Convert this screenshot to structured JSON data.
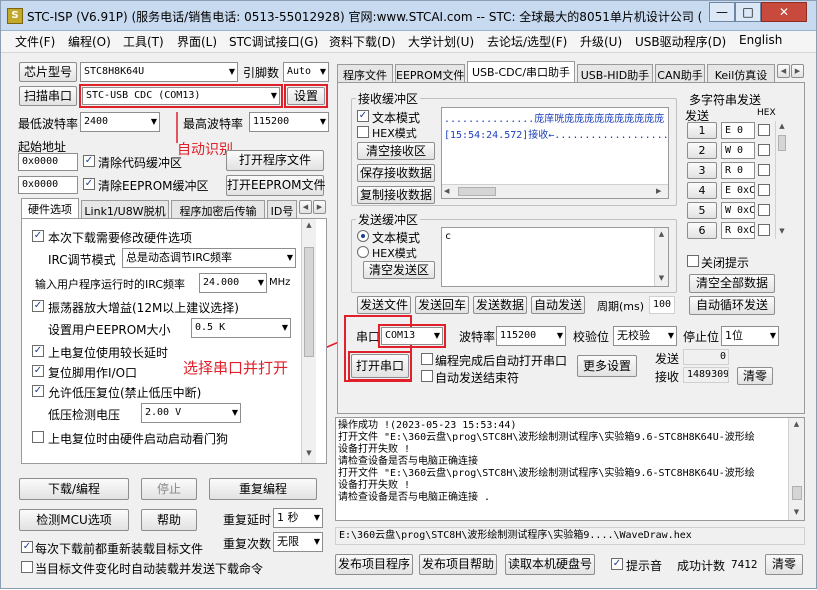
{
  "window": {
    "title": "STC-ISP (V6.91P) (服务电话/销售电话: 0513-55012928) 官网:www.STCAI.com  -- STC: 全球最大的8051单片机设计公司 (",
    "icon": "stc-chip-icon",
    "minimize": "—",
    "maximize": "□",
    "close": "✕"
  },
  "menu": [
    "文件(F)",
    "编程(O)",
    "工具(T)",
    "界面(L)",
    "STC调试接口(G)",
    "资料下载(D)",
    "大学计划(U)",
    "去论坛/选型(F)",
    "升级(U)",
    "USB驱动程序(D)",
    "English"
  ],
  "left": {
    "chip_btn": "芯片型号",
    "chip_value": "STC8H8K64U",
    "pins_label": "引脚数",
    "pins_value": "Auto",
    "scan_btn": "扫描串口",
    "port_value": "STC-USB CDC (COM13)",
    "settings_btn": "设置",
    "min_baud_label": "最低波特率",
    "min_baud_value": "2400",
    "max_baud_label": "最高波特率",
    "max_baud_value": "115200",
    "start_addr_label": "起始地址",
    "addr1": "0x0000",
    "clear_code": "清除代码缓冲区",
    "open_prog_btn": "打开程序文件",
    "addr2": "0x0000",
    "clear_eeprom": "清除EEPROM缓冲区",
    "open_eeprom_btn": "打开EEPROM文件",
    "annotation_auto": "自动识别",
    "tabs": [
      "硬件选项",
      "Link1/U8W脱机",
      "程序加密后传输",
      "ID号"
    ],
    "opt1": "本次下载需要修改硬件选项",
    "irc_label": "IRC调节模式",
    "irc_value": "总是动态调节IRC频率",
    "freq_label": "输入用户程序运行时的IRC频率",
    "freq_value": "24.000",
    "freq_unit": "MHz",
    "opt2": "振荡器放大增益(12M以上建议选择)",
    "eeprom_label": "设置用户EEPROM大小",
    "eeprom_value": "0.5 K",
    "opt3": "上电复位使用较长延时",
    "opt4": "复位脚用作I/O口",
    "opt5": "允许低压复位(禁止低压中断)",
    "lv_label": "低压检测电压",
    "lv_value": "2.00 V",
    "opt6": "上电复位时由硬件启动启动看门狗",
    "download_btn": "下载/编程",
    "stop_btn": "停止",
    "reprog_btn": "重复编程",
    "detect_btn": "检测MCU选项",
    "help_btn": "帮助",
    "repeat_delay_label": "重复延时",
    "repeat_delay_value": "1 秒",
    "reload_opt": "每次下载前都重新装载目标文件",
    "repeat_count_label": "重复次数",
    "repeat_count_value": "无限",
    "auto_load_opt": "当目标文件变化时自动装载并发送下载命令"
  },
  "right": {
    "tabs": [
      "程序文件",
      "EEPROM文件",
      "USB-CDC/串口助手",
      "USB-HID助手",
      "CAN助手",
      "Keil仿真设"
    ],
    "recv": {
      "title": "接收缓冲区",
      "text_mode": "文本模式",
      "hex_mode": "HEX模式",
      "clear_btn": "清空接收区",
      "save_btn": "保存接收数据",
      "copy_btn": "复制接收数据",
      "line1": "...............庞庠咣庞庞庞庞庞庞庞庞庞庞",
      "line2": "[15:54:24.572]接收←..................."
    },
    "multi": {
      "title": "多字符串发送",
      "send_col": "发送",
      "hex_col": "HEX",
      "rows": [
        {
          "n": "1",
          "v": "E 0"
        },
        {
          "n": "2",
          "v": "W 0"
        },
        {
          "n": "3",
          "v": "R 0"
        },
        {
          "n": "4",
          "v": "E 0xC"
        },
        {
          "n": "5",
          "v": "W 0xC"
        },
        {
          "n": "6",
          "v": "R 0xC"
        }
      ],
      "close_hint": "关闭提示",
      "clear_all_btn": "清空全部数据",
      "auto_loop_btn": "自动循环发送"
    },
    "send": {
      "title": "发送缓冲区",
      "text_mode": "文本模式",
      "hex_mode": "HEX模式",
      "clear_btn": "清空发送区",
      "content": "c",
      "file_btn": "发送文件",
      "cr_btn": "发送回车",
      "data_btn": "发送数据",
      "auto_btn": "自动发送",
      "period_label": "周期(ms)",
      "period_value": "100"
    },
    "serial": {
      "port_label": "串口",
      "port_value": "COM13",
      "baud_label": "波特率",
      "baud_value": "115200",
      "parity_label": "校验位",
      "parity_value": "无校验",
      "stop_label": "停止位",
      "stop_value": "1位",
      "open_btn": "打开串口",
      "auto_open": "编程完成后自动打开串口",
      "auto_end": "自动发送结束符",
      "more_btn": "更多设置",
      "send_label": "发送",
      "send_value": "0",
      "recv_label": "接收",
      "recv_value": "1489309",
      "clear_btn": "清零"
    },
    "annotation_open": "选择串口并打开",
    "log": [
      "操作成功 !(2023-05-23 15:53:44)",
      "打开文件 \"E:\\360云盘\\prog\\STC8H\\波形绘制测试程序\\实验箱9.6-STC8H8K64U-波形绘",
      "设备打开失败 !",
      "请检查设备是否与电脑正确连接",
      "打开文件 \"E:\\360云盘\\prog\\STC8H\\波形绘制测试程序\\实验箱9.6-STC8H8K64U-波形绘",
      "设备打开失败 !",
      "请检查设备是否与电脑正确连接 ."
    ],
    "path": "E:\\360云盘\\prog\\STC8H\\波形绘制测试程序\\实验箱9....\\WaveDraw.hex",
    "publish_btn": "发布项目程序",
    "publish_help_btn": "发布项目帮助",
    "read_disk_btn": "读取本机硬盘号",
    "beep_opt": "提示音",
    "success_label": "成功计数",
    "success_value": "7412",
    "clear_btn": "清零"
  }
}
